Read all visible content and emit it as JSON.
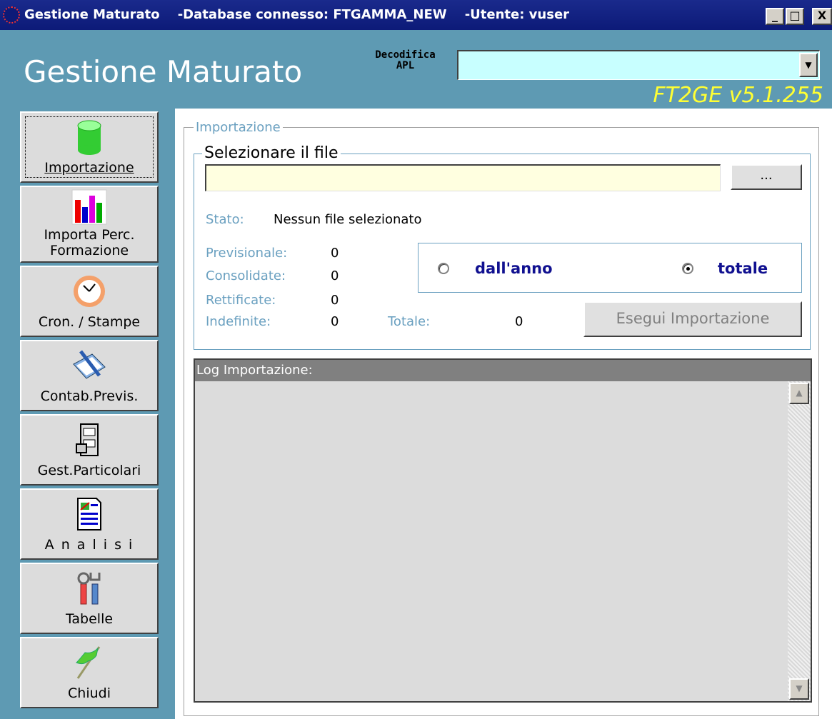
{
  "window": {
    "title_app": "Gestione Maturato",
    "title_db": "-Database connesso: FTGAMMA_NEW",
    "title_user": "-Utente: vuser",
    "minimize_label": "_",
    "maximize_label": "□",
    "close_label": "X"
  },
  "header": {
    "title": "Gestione Maturato",
    "decodifica_label_line1": "Decodifica",
    "decodifica_label_line2": "APL",
    "decodifica_value": "",
    "version": "FT2GE v5.1.255"
  },
  "sidebar": {
    "items": [
      {
        "label": "Importazione",
        "icon": "database-icon"
      },
      {
        "label_line1": "Importa Perc.",
        "label_line2": "Formazione",
        "icon": "bar-chart-icon"
      },
      {
        "label": "Cron. / Stampe",
        "icon": "clock-icon"
      },
      {
        "label": "Contab.Previs.",
        "icon": "book-pen-icon"
      },
      {
        "label": "Gest.Particolari",
        "icon": "file-cabinet-icon"
      },
      {
        "label": "A n a l i s i",
        "icon": "report-icon"
      },
      {
        "label": "Tabelle",
        "icon": "tools-icon"
      },
      {
        "label": "Chiudi",
        "icon": "flag-icon"
      }
    ]
  },
  "importazione": {
    "group_label": "Importazione",
    "file_group_label": "Selezionare il file",
    "file_value": "",
    "browse_label": "...",
    "stato_label": "Stato:",
    "stato_value": "Nessun file selezionato",
    "previsionale_label": "Previsionale:",
    "previsionale_value": "0",
    "consolidate_label": "Consolidate:",
    "consolidate_value": "0",
    "rettificate_label": "Rettificate:",
    "rettificate_value": "0",
    "indefinite_label": "Indefinite:",
    "indefinite_value": "0",
    "totale_label": "Totale:",
    "totale_value": "0",
    "radio_anno_label": "dall'anno",
    "radio_totale_label": "totale",
    "radio_selected": "totale",
    "exec_label": "Esegui Importazione",
    "log_label": "Log Importazione:"
  }
}
